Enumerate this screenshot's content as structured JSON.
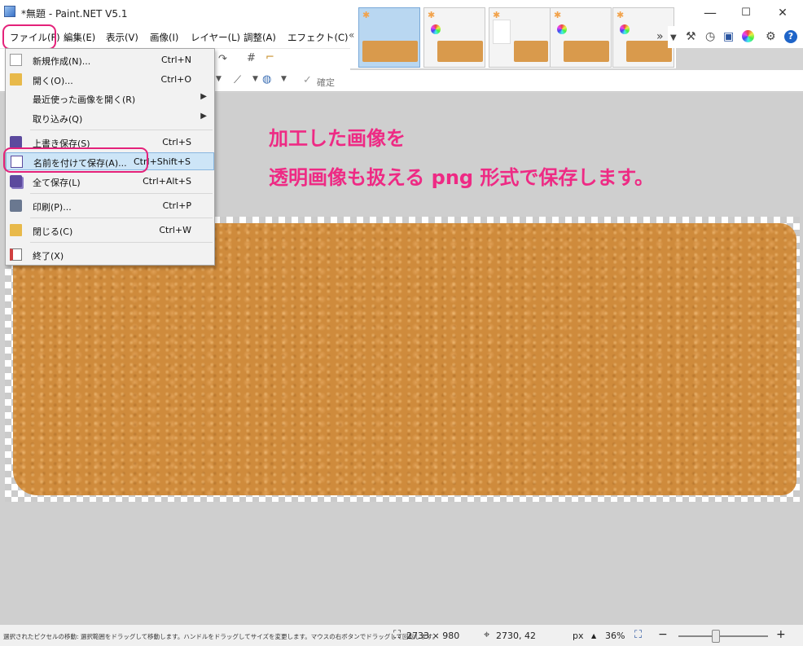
{
  "window": {
    "title": "*無題 - Paint.NET V5.1",
    "minimize": "—",
    "maximize": "☐",
    "close": "✕"
  },
  "menu": {
    "file": "ファイル(F)",
    "edit": "編集(E)",
    "view": "表示(V)",
    "image": "画像(I)",
    "layers": "レイヤー(L)",
    "adjustments": "調整(A)",
    "effects": "エフェクト(C)"
  },
  "file_menu": {
    "items": [
      {
        "label": "新規作成(N)...",
        "shortcut": "Ctrl+N",
        "icon": "new-file-icon"
      },
      {
        "label": "開く(O)...",
        "shortcut": "Ctrl+O",
        "icon": "open-folder-icon"
      },
      {
        "label": "最近使った画像を開く(R)",
        "shortcut": "",
        "icon": "",
        "submenu": "▶"
      },
      {
        "label": "取り込み(Q)",
        "shortcut": "",
        "icon": "",
        "submenu": "▶"
      },
      {
        "label": "上書き保存(S)",
        "shortcut": "Ctrl+S",
        "icon": "save-icon"
      },
      {
        "label": "名前を付けて保存(A)...",
        "shortcut": "Ctrl+Shift+S",
        "icon": "save-as-icon"
      },
      {
        "label": "全て保存(L)",
        "shortcut": "Ctrl+Alt+S",
        "icon": "save-all-icon"
      },
      {
        "label": "印刷(P)...",
        "shortcut": "Ctrl+P",
        "icon": "print-icon"
      },
      {
        "label": "閉じる(C)",
        "shortcut": "Ctrl+W",
        "icon": "close-file-icon"
      },
      {
        "label": "終了(X)",
        "shortcut": "",
        "icon": "exit-icon"
      }
    ]
  },
  "toolbar": {
    "confirm": "確定",
    "confirm_check": "✓"
  },
  "annotation": {
    "line1": "加工した画像を",
    "line2": "透明画像も扱える png 形式で保存します。"
  },
  "thumbnails": {
    "prev_arrow": "«",
    "next_arrow": "»",
    "asterisk": "✱"
  },
  "status": {
    "hint": "選択されたピクセルの移動: 選択範囲をドラッグして移動します。ハンドルをドラッグしてサイズを変更します。マウスの右ボタンでドラッグして回転します。",
    "image_size": "2733 × 980",
    "cursor_pos": "2730, 42",
    "units": "px",
    "units_arrow": "▲",
    "zoom": "36%",
    "zoom_out": "−",
    "zoom_in": "+"
  },
  "colors": {
    "highlight": "#e4227a",
    "annotation": "#ee2a84",
    "menu_hover": "#cde5f7"
  }
}
